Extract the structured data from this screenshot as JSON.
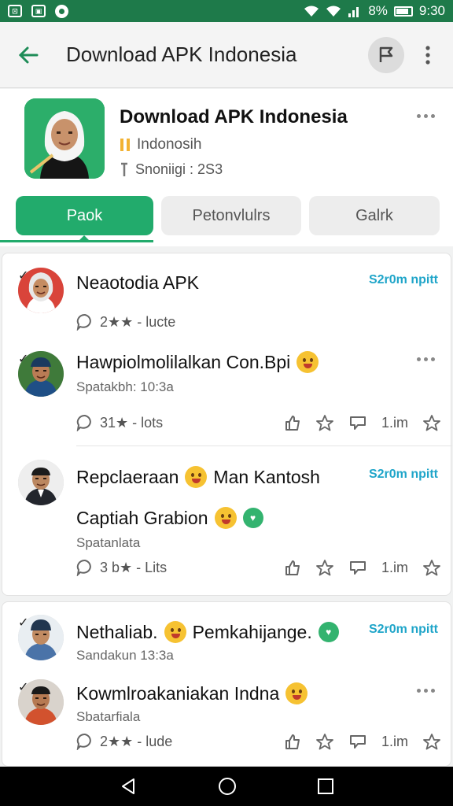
{
  "status_bar": {
    "left_icons": [
      "image-icon",
      "notification-icon",
      "sync-icon"
    ],
    "battery": "8%",
    "time": "9:30"
  },
  "appbar": {
    "title": "Download APK Indonesia"
  },
  "header": {
    "app_name": "Download APK Indonesia",
    "subtitle": "Indonosih",
    "meta": "Snoniigi : 2S3"
  },
  "tabs": [
    {
      "label": "Paok"
    },
    {
      "label": "Petonvlulrs"
    },
    {
      "label": "Galrk"
    }
  ],
  "feed": [
    {
      "title": "Neaotodia APK",
      "time": "S2r0m npitt",
      "stats": "2★★ - lucte"
    },
    {
      "title": "Hawpiolmolilalkan Con.Bpi",
      "subtitle": "Spatakbh: 10:3a",
      "stats": "31★ - lots",
      "count": "1.im"
    },
    {
      "title": "Repclaeraan",
      "title_suffix": "Man Kantosh",
      "line2": "Captiah Grabion",
      "time": "S2r0m npitt",
      "subtitle": "Spatanlata",
      "stats": "3 b★ - Lits",
      "count": "1.im"
    },
    {
      "title": "Nethaliab.",
      "title_suffix": "Pemkahijange.",
      "time": "S2r0m npitt",
      "subtitle": "Sandakun 13:3a"
    },
    {
      "title": "Kowmlroakaniakan Indna",
      "subtitle": "Sbatarfiala",
      "stats": "2★★ - lude",
      "count": "1.im"
    }
  ],
  "colors": {
    "brand_green": "#22ab6c",
    "status_green": "#1e7a4a",
    "time_blue": "#1fa5c9"
  }
}
